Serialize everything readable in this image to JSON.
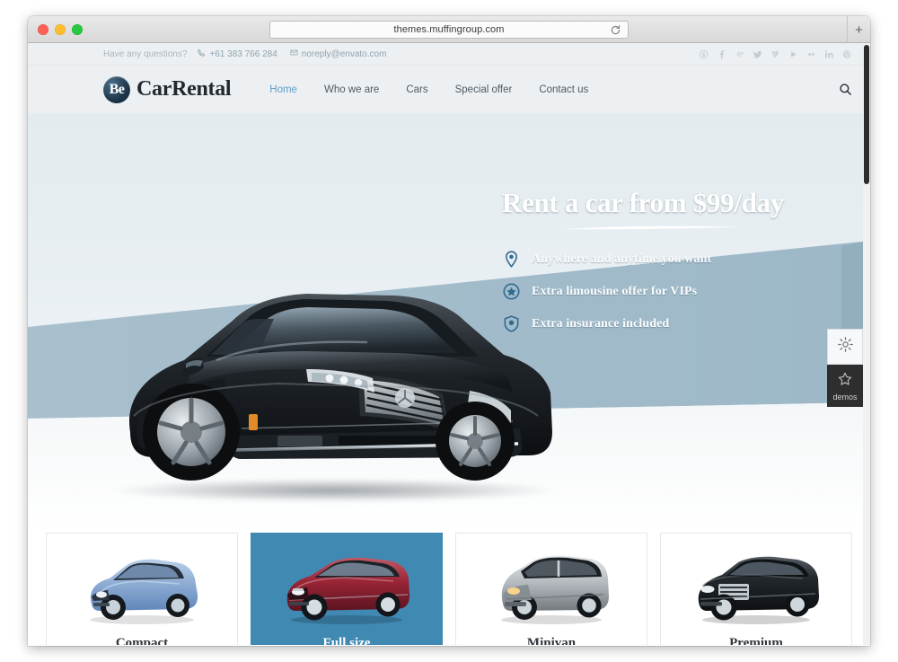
{
  "browser": {
    "url": "themes.muffingroup.com",
    "reload_icon": "reload-icon",
    "new_tab_label": "+",
    "traffic_lights": [
      "close",
      "minimize",
      "maximize"
    ]
  },
  "site": {
    "topbar": {
      "question": "Have any questions?",
      "phone_icon": "phone-icon",
      "phone": "+61 383 766 284",
      "email_icon": "envelope-icon",
      "email": "noreply@envato.com",
      "socials": [
        {
          "name": "skype-icon",
          "glyph": "S"
        },
        {
          "name": "facebook-icon",
          "glyph": "f"
        },
        {
          "name": "google-plus-icon",
          "glyph": "g+"
        },
        {
          "name": "twitter-icon",
          "glyph": "t"
        },
        {
          "name": "vimeo-icon",
          "glyph": "V"
        },
        {
          "name": "youtube-icon",
          "glyph": "▶"
        },
        {
          "name": "flickr-icon",
          "glyph": "••"
        },
        {
          "name": "linkedin-icon",
          "glyph": "in"
        },
        {
          "name": "pinterest-icon",
          "glyph": "P"
        }
      ]
    },
    "logo": {
      "mark": "Be",
      "text": "CarRental"
    },
    "nav": [
      {
        "label": "Home",
        "active": true
      },
      {
        "label": "Who we are",
        "active": false
      },
      {
        "label": "Cars",
        "active": false
      },
      {
        "label": "Special offer",
        "active": false
      },
      {
        "label": "Contact us",
        "active": false
      }
    ],
    "search_icon": "search-icon"
  },
  "hero": {
    "title": "Rent a car from $99/day",
    "features": [
      {
        "icon": "map-pin-icon",
        "text": "Anywhere and anytime you want"
      },
      {
        "icon": "star-badge-icon",
        "text": "Extra limousine offer for VIPs"
      },
      {
        "icon": "shield-icon",
        "text": "Extra insurance included"
      }
    ],
    "band_color": "#9fb9c9",
    "car_alt": "black-luxury-sedan"
  },
  "demo_widget": {
    "gear_icon": "gear-icon",
    "star_icon": "star-icon",
    "label": "demos"
  },
  "cards": [
    {
      "label": "Compact",
      "color": "#7fa8d8",
      "active": false
    },
    {
      "label": "Full size",
      "color": "#9e2f3f",
      "active": true
    },
    {
      "label": "Minivan",
      "color": "#b9bcbe",
      "active": false
    },
    {
      "label": "Premium",
      "color": "#2b2f34",
      "active": false
    }
  ],
  "colors": {
    "accent": "#4089b3",
    "nav_active": "#5fa0c8",
    "header_bg": "#edf0f2",
    "hero_band": "#9fb9c9"
  }
}
